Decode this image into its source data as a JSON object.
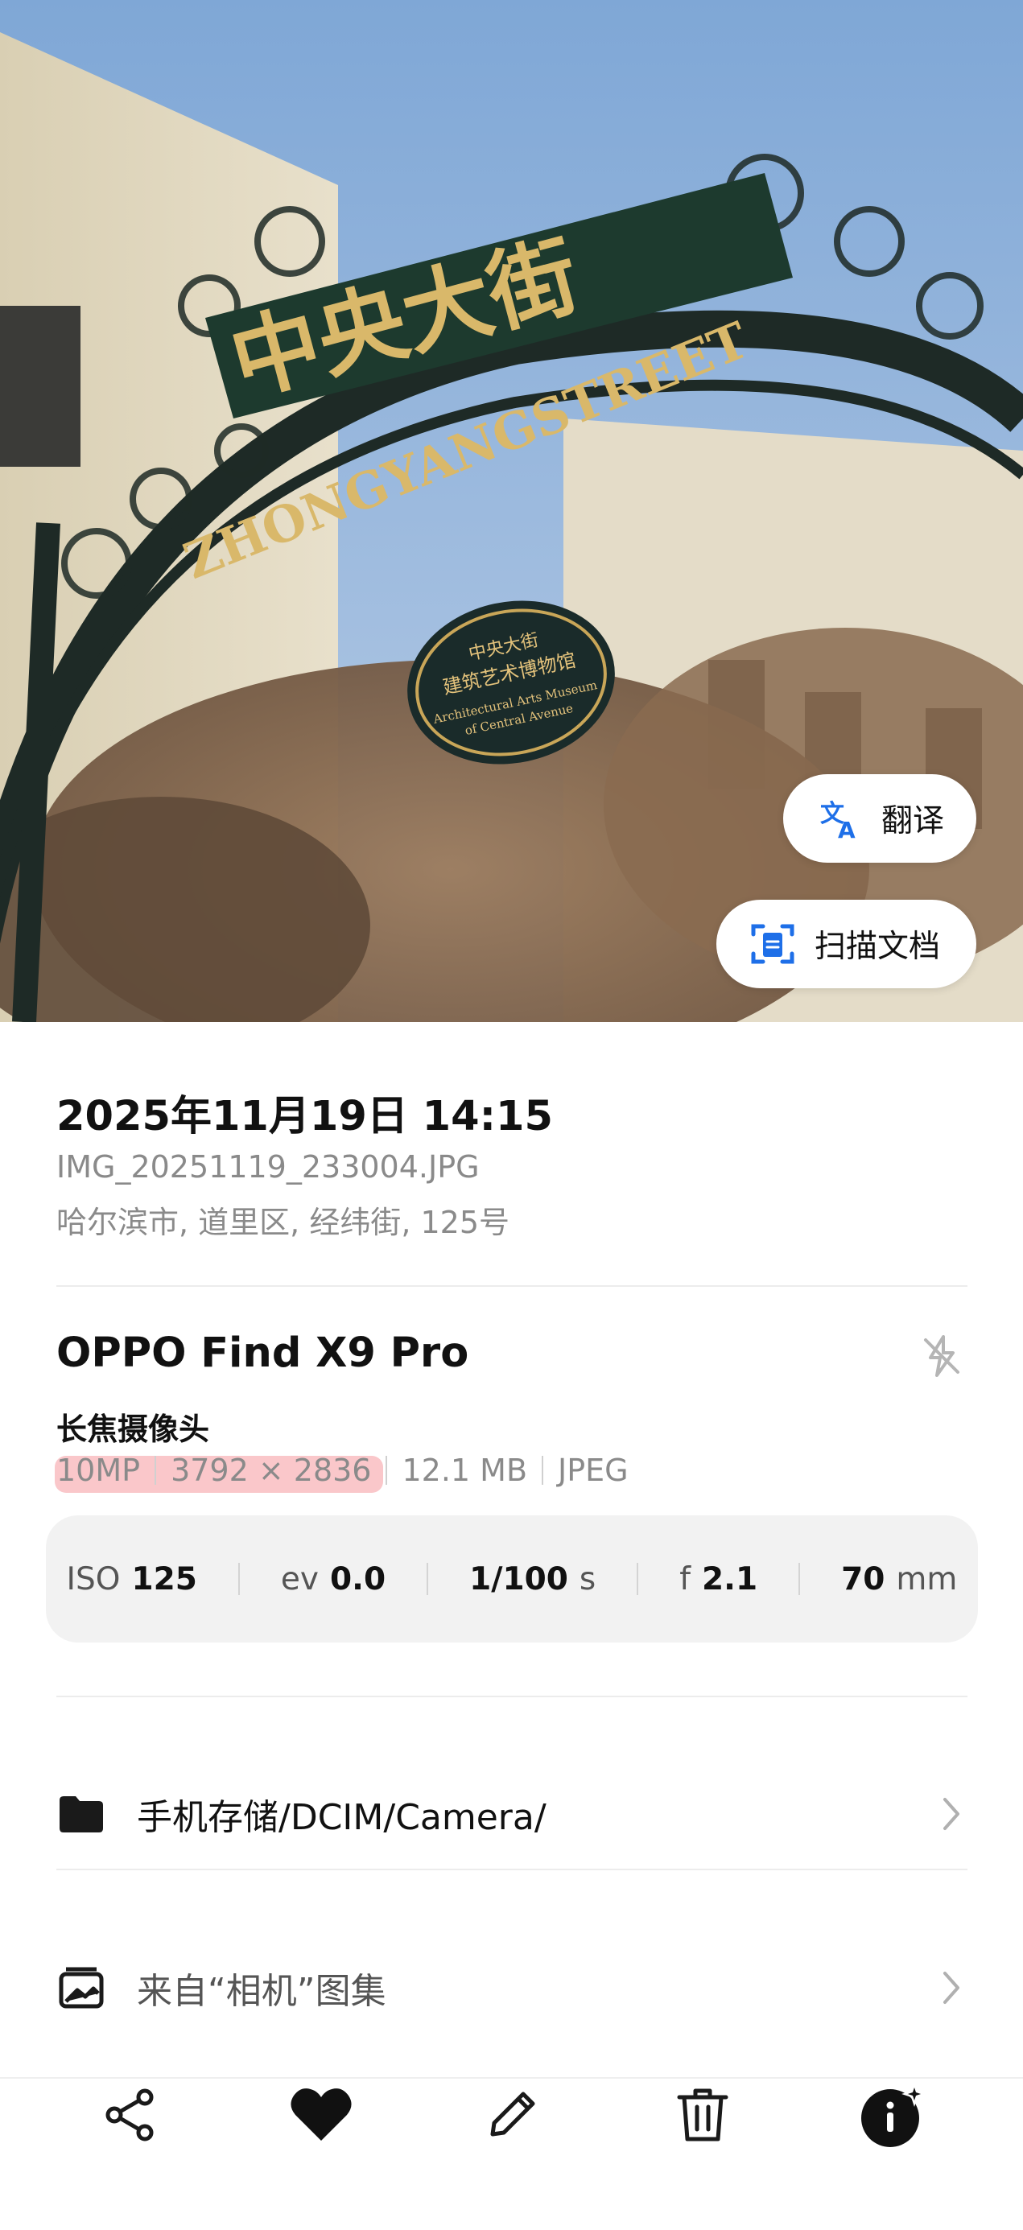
{
  "chips": {
    "translate": "翻译",
    "scan": "扫描文档"
  },
  "photo_signs": {
    "main_sign": "中央大街",
    "arch_text": "ZHONGYANGSTREET",
    "plaque_line1": "中央大街",
    "plaque_line2": "建筑艺术博物馆",
    "plaque_line3": "Architectural Arts Museum",
    "plaque_line4": "of Central Avenue"
  },
  "info": {
    "datetime": "2025年11月19日 14:15",
    "filename": "IMG_20251119_233004.JPG",
    "location": "哈尔滨市, 道里区, 经纬街, 125号",
    "device": "OPPO Find X9 Pro",
    "lens": "长焦摄像头",
    "resolution_mp": "10MP",
    "dimensions": "3792 × 2836",
    "file_size": "12.1 MB",
    "format": "JPEG"
  },
  "exif": {
    "iso_label": "ISO",
    "iso_value": "125",
    "ev_label": "ev",
    "ev_value": "0.0",
    "shutter_value": "1/100",
    "shutter_unit": "s",
    "aperture_label": "f",
    "aperture_value": "2.1",
    "focal_value": "70",
    "focal_unit": "mm"
  },
  "rows": {
    "storage_path": "手机存储/DCIM/Camera/",
    "album": "来自“相机”图集"
  },
  "toolbar_icons": [
    "share-icon",
    "heart-icon",
    "edit-icon",
    "delete-icon",
    "info-icon"
  ],
  "colors": {
    "accent_blue": "#1e6fe8",
    "highlight": "#f0505a",
    "sheet_bg": "#ffffff",
    "exif_bg": "#f2f2f2"
  }
}
